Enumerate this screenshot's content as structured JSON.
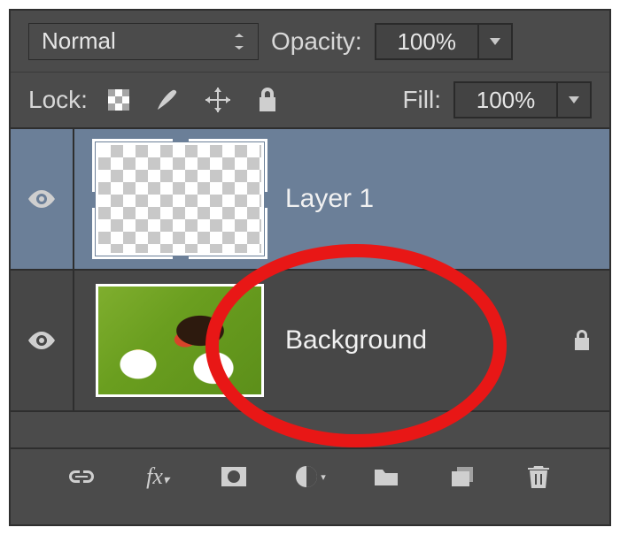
{
  "header": {
    "blend_mode": "Normal",
    "opacity_label": "Opacity:",
    "opacity_value": "100%",
    "lock_label": "Lock:",
    "fill_label": "Fill:",
    "fill_value": "100%"
  },
  "layers": [
    {
      "name": "Layer 1",
      "selected": true,
      "visible": true,
      "locked": false,
      "transparent": true
    },
    {
      "name": "Background",
      "selected": false,
      "visible": true,
      "locked": true,
      "transparent": false
    }
  ],
  "annotation": {
    "shape": "ellipse",
    "color": "#e81716",
    "target_layer_index": 0
  }
}
